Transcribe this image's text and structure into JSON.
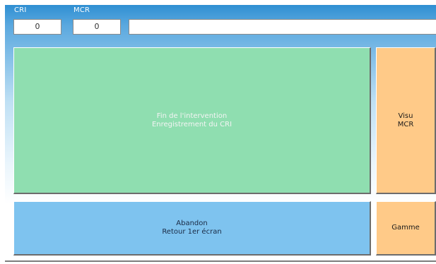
{
  "header": {
    "cri_label": "CRI",
    "mcr_label": "MCR",
    "cri_value": "0",
    "mcr_value": "0",
    "message": ""
  },
  "buttons": {
    "fin": {
      "line1": "Fin de l'intervention",
      "line2": "Enregistrement du CRI"
    },
    "visu": {
      "line1": "Visu",
      "line2": "MCR"
    },
    "abandon": {
      "line1": "Abandon",
      "line2": "Retour 1er écran"
    },
    "gamme": {
      "label": "Gamme"
    }
  },
  "colors": {
    "header_gradient_top": "#2f8fd2",
    "fin_button": "#8fdeb0",
    "side_buttons": "#ffca88",
    "abandon_button": "#7ec3ef"
  }
}
